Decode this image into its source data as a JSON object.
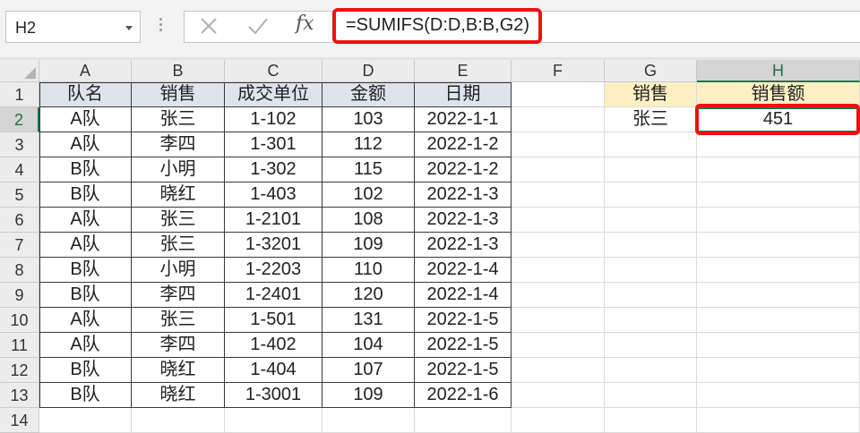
{
  "name_box": "H2",
  "formula": "=SUMIFS(D:D,B:B,G2)",
  "fx_label": "fx",
  "columns": [
    "A",
    "B",
    "C",
    "D",
    "E",
    "F",
    "G",
    "H"
  ],
  "rows": [
    "1",
    "2",
    "3",
    "4",
    "5",
    "6",
    "7",
    "8",
    "9",
    "10",
    "11",
    "12",
    "13",
    "14"
  ],
  "table": {
    "headers": [
      "队名",
      "销售",
      "成交单位",
      "金额",
      "日期"
    ],
    "rows": [
      [
        "A队",
        "张三",
        "1-102",
        "103",
        "2022-1-1"
      ],
      [
        "A队",
        "李四",
        "1-301",
        "112",
        "2022-1-2"
      ],
      [
        "B队",
        "小明",
        "1-302",
        "115",
        "2022-1-2"
      ],
      [
        "B队",
        "晓红",
        "1-403",
        "102",
        "2022-1-3"
      ],
      [
        "A队",
        "张三",
        "1-2101",
        "108",
        "2022-1-3"
      ],
      [
        "A队",
        "张三",
        "1-3201",
        "109",
        "2022-1-3"
      ],
      [
        "B队",
        "小明",
        "1-2203",
        "110",
        "2022-1-4"
      ],
      [
        "B队",
        "李四",
        "1-2401",
        "120",
        "2022-1-4"
      ],
      [
        "A队",
        "张三",
        "1-501",
        "131",
        "2022-1-5"
      ],
      [
        "A队",
        "李四",
        "1-402",
        "104",
        "2022-1-5"
      ],
      [
        "B队",
        "晓红",
        "1-404",
        "107",
        "2022-1-5"
      ],
      [
        "B队",
        "晓红",
        "1-3001",
        "109",
        "2022-1-6"
      ]
    ]
  },
  "summary": {
    "g1": "销售",
    "h1": "销售额",
    "g2": "张三",
    "h2": "451"
  },
  "colors": {
    "highlight": "#ee1111",
    "header_fill": "#dde4ee",
    "summary_fill": "#fff0c4",
    "excel_green": "#217346"
  }
}
